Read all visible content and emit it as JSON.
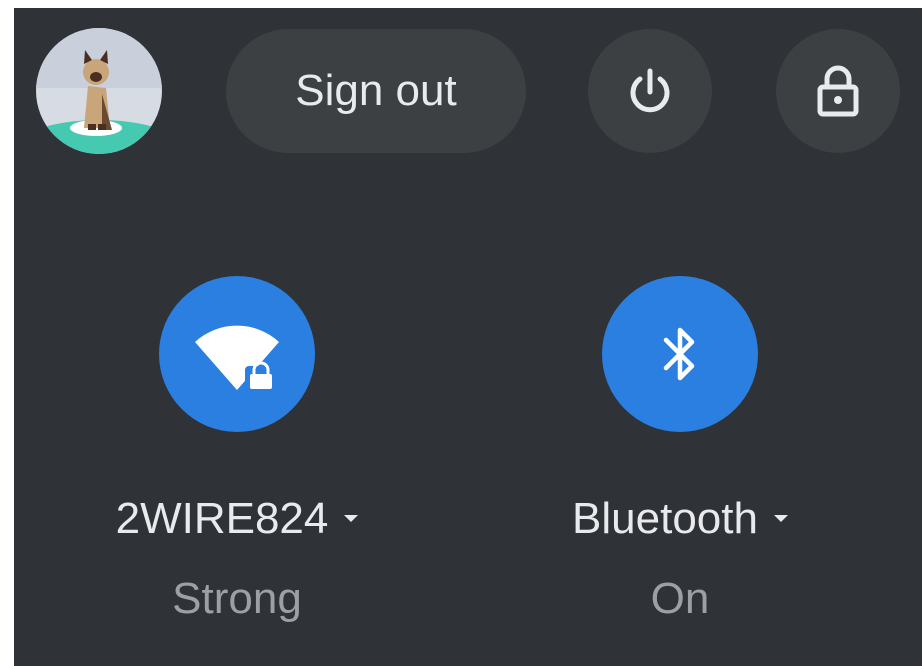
{
  "user": {
    "avatar_icon": "cat-avatar-icon"
  },
  "header": {
    "sign_out_label": "Sign out",
    "power_icon": "power-icon",
    "lock_icon": "lock-icon"
  },
  "features": {
    "wifi": {
      "icon": "wifi-secure-icon",
      "label": "2WIRE824",
      "status": "Strong",
      "active": true
    },
    "bluetooth": {
      "icon": "bluetooth-icon",
      "label": "Bluetooth",
      "status": "On",
      "active": true
    }
  },
  "colors": {
    "panel_bg": "#2f3236",
    "button_bg": "#3d4043",
    "accent": "#2a7fe0",
    "text_primary": "#e8eaed",
    "text_secondary": "#9aa0a6"
  }
}
